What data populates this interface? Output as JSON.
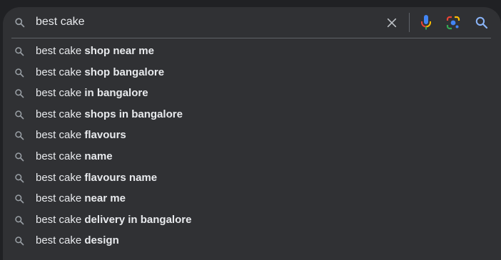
{
  "search": {
    "query": "best cake"
  },
  "icons": {
    "search": "search-icon",
    "clear": "close-icon",
    "voice": "microphone-icon",
    "lens": "google-lens-icon",
    "submit": "search-icon"
  },
  "colors": {
    "background": "#202124",
    "dropdown": "#303134",
    "text": "#e8eaed",
    "icon": "#9aa0a6",
    "submit_icon": "#8ab4f8"
  },
  "suggestions": [
    {
      "prefix": "best cake",
      "completion": "shop near me"
    },
    {
      "prefix": "best cake",
      "completion": "shop bangalore"
    },
    {
      "prefix": "best cake",
      "completion": "in bangalore"
    },
    {
      "prefix": "best cake",
      "completion": "shops in bangalore"
    },
    {
      "prefix": "best cake",
      "completion": "flavours"
    },
    {
      "prefix": "best cake",
      "completion": "name"
    },
    {
      "prefix": "best cake",
      "completion": "flavours name"
    },
    {
      "prefix": "best cake",
      "completion": "near me"
    },
    {
      "prefix": "best cake",
      "completion": "delivery in bangalore"
    },
    {
      "prefix": "best cake",
      "completion": "design"
    }
  ]
}
